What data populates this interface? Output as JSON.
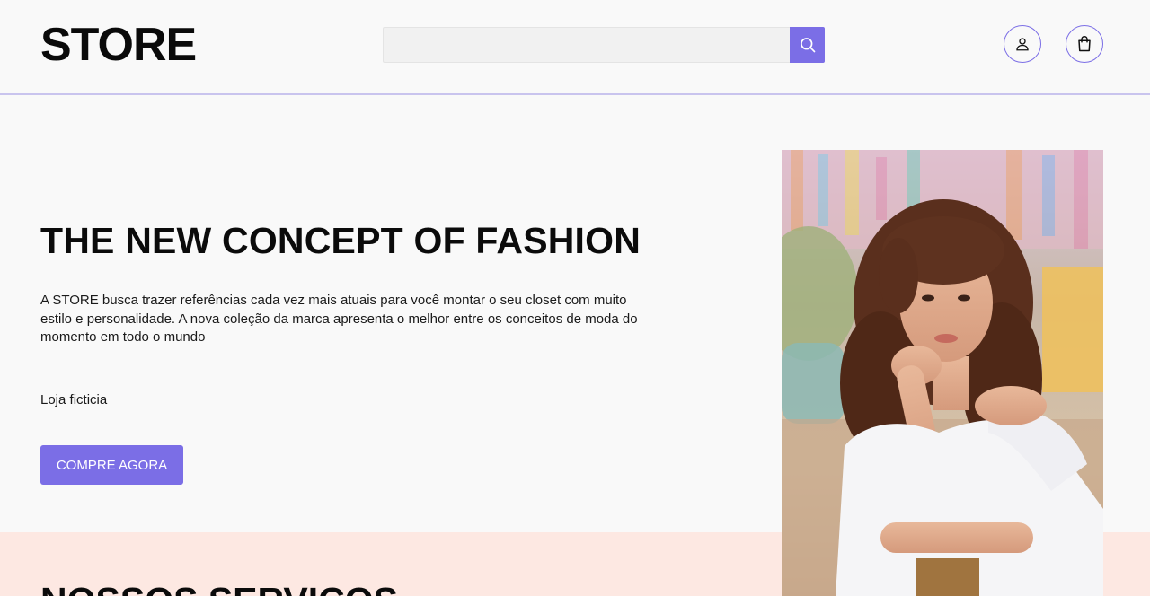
{
  "header": {
    "logo": "STORE",
    "search": {
      "value": "",
      "placeholder": ""
    },
    "search_icon": "search-icon",
    "user_icon": "user-icon",
    "cart_icon": "shopping-bag-icon"
  },
  "hero": {
    "title": "THE NEW CONCEPT OF FASHION",
    "description": "A STORE busca trazer referências cada vez mais atuais para você montar o seu closet com muito estilo e personalidade. A nova coleção da marca apresenta o melhor entre os conceitos de moda do momento em todo o mundo",
    "note": "Loja ficticia",
    "cta_label": "COMPRE AGORA",
    "image_alt": "model-photo"
  },
  "services": {
    "title": "NOSSOS SERVIÇOS"
  },
  "colors": {
    "accent": "#7b6ee6",
    "background": "#f9f9f9",
    "services_band": "#fde8e2",
    "header_border": "#c9c4ee"
  }
}
